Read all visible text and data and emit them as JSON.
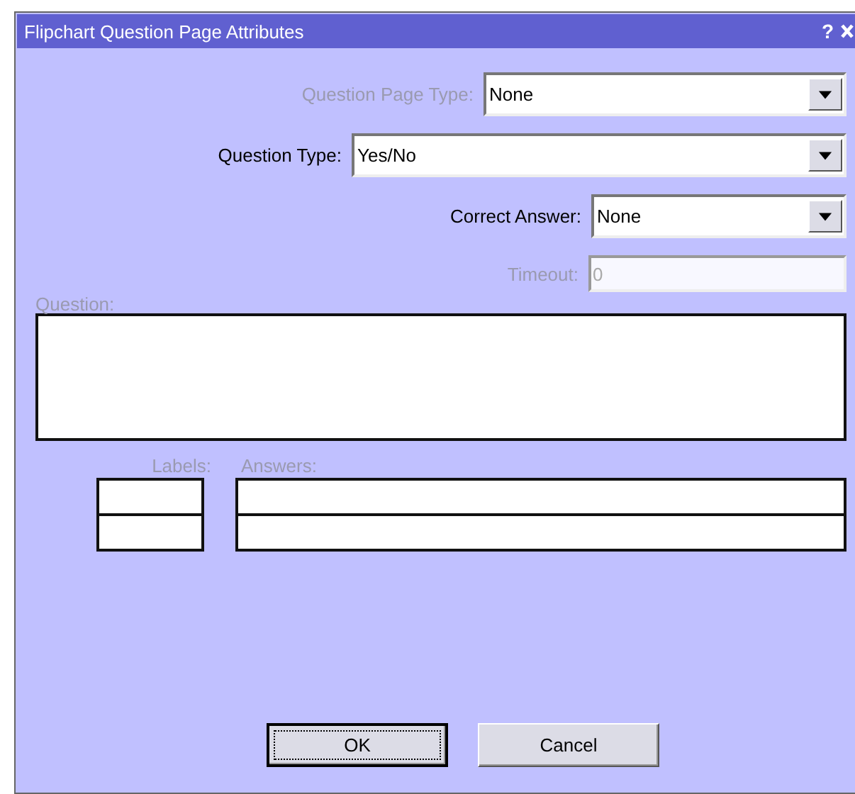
{
  "window": {
    "title": "Flipchart Question Page Attributes",
    "help": "?"
  },
  "fields": [
    {
      "kind": "combo",
      "label": "Question Page Type:",
      "value": "None",
      "disabled": true
    },
    {
      "kind": "combo",
      "label": "Question Type:",
      "value": "Yes/No",
      "disabled": false
    },
    {
      "kind": "combo",
      "label": "Correct Answer:",
      "value": "None",
      "disabled": false
    },
    {
      "kind": "text",
      "label": "Timeout:",
      "value": "0",
      "disabled": true
    }
  ],
  "question": {
    "label": "Question:",
    "disabled": true
  },
  "answers": {
    "labels_heading": "Labels:",
    "answers_heading": "Answers:",
    "disabled": true,
    "rows": [
      {
        "kind": "blank"
      },
      {
        "kind": "blank"
      }
    ]
  },
  "buttons": [
    {
      "label": "OK",
      "default": true
    },
    {
      "label": "Cancel",
      "default": false
    }
  ]
}
